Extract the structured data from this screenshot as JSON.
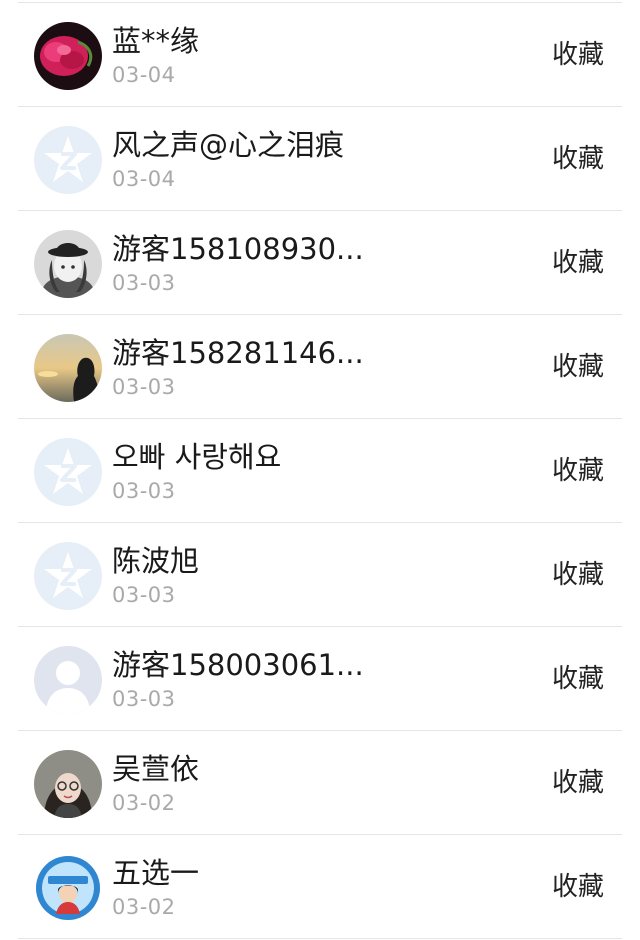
{
  "items": [
    {
      "name": "蓝**缘",
      "date": "03-04",
      "action": "收藏",
      "avatar": "flower-avatar"
    },
    {
      "name": "风之声@心之泪痕",
      "date": "03-04",
      "action": "收藏",
      "avatar": "qzone-default-avatar"
    },
    {
      "name": "游客158108930...",
      "date": "03-03",
      "action": "收藏",
      "avatar": "anime-girl-hat-avatar"
    },
    {
      "name": "游客158281146...",
      "date": "03-03",
      "action": "收藏",
      "avatar": "sunset-silhouette-avatar"
    },
    {
      "name": "오빠 사랑해요",
      "date": "03-03",
      "action": "收藏",
      "avatar": "qzone-default-avatar"
    },
    {
      "name": "陈波旭",
      "date": "03-03",
      "action": "收藏",
      "avatar": "qzone-default-avatar"
    },
    {
      "name": "游客158003061...",
      "date": "03-03",
      "action": "收藏",
      "avatar": "default-person-avatar"
    },
    {
      "name": "吴萱依",
      "date": "03-02",
      "action": "收藏",
      "avatar": "girl-glasses-avatar"
    },
    {
      "name": "五选一",
      "date": "03-02",
      "action": "收藏",
      "avatar": "cartoon-badge-avatar"
    }
  ],
  "colors": {
    "date_gray": "#a9a9a9",
    "divider": "#e5e5e5",
    "qzone_bg": "#e6eef8",
    "qzone_star": "#ffffff"
  }
}
